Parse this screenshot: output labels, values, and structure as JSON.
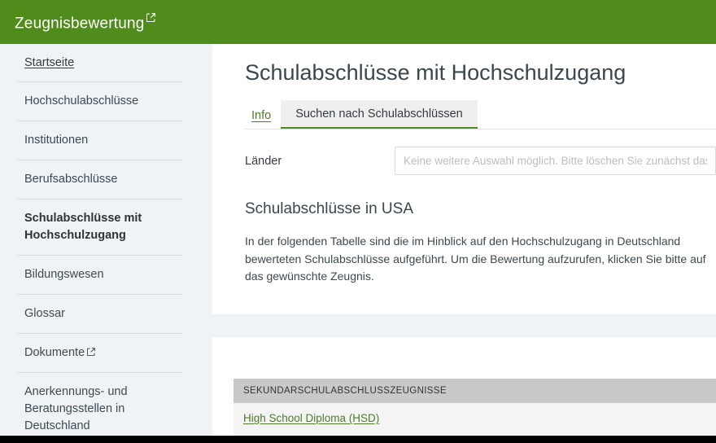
{
  "header": {
    "title": "Zeugnisbewertung",
    "external_icon": "external-link-icon",
    "bg_color": "#4f8c1b"
  },
  "sidebar": {
    "items": [
      {
        "label": "Startseite",
        "state": "link",
        "external": false
      },
      {
        "label": "Hochschulabschlüsse",
        "state": "normal",
        "external": false
      },
      {
        "label": "Institutionen",
        "state": "normal",
        "external": false
      },
      {
        "label": "Berufsabschlüsse",
        "state": "normal",
        "external": false
      },
      {
        "label": "Schulabschlüsse mit Hochschulzugang",
        "state": "active",
        "external": false
      },
      {
        "label": "Bildungswesen",
        "state": "normal",
        "external": false
      },
      {
        "label": "Glossar",
        "state": "normal",
        "external": false
      },
      {
        "label": "Dokumente",
        "state": "normal",
        "external": true
      },
      {
        "label": "Anerkennungs- und Beratungsstellen in Deutschland",
        "state": "normal",
        "external": false
      }
    ]
  },
  "main": {
    "page_title": "Schulabschlüsse mit Hochschulzugang",
    "tabs": [
      {
        "label": "Info",
        "active": false
      },
      {
        "label": "Suchen nach Schulabschlüssen",
        "active": true
      }
    ],
    "form": {
      "laender_label": "Länder",
      "laender_value": "",
      "laender_placeholder": "Keine weitere Auswahl möglich. Bitte löschen Sie zunächst das ausg"
    },
    "section": {
      "heading": "Schulabschlüsse in USA",
      "paragraph": "In der folgenden Tabelle sind die im Hinblick auf den Hochschulzugang in Deutschland bewerteten Schulabschlüsse aufgeführt. Um die Bewertung aufzurufen, klicken Sie bitte auf das gewünschte Zeugnis."
    },
    "table": {
      "header": "SEKUNDARSCHULABSCHLUSSZEUGNISSE",
      "rows": [
        {
          "label": "High School Diploma (HSD)"
        }
      ]
    }
  },
  "colors": {
    "brand_green": "#4f8c1b",
    "link_green": "#4d7c2a",
    "sidebar_bg": "#eff3f6",
    "table_header_bg": "#c9c9c9",
    "table_row_bg": "#f4f4f4"
  }
}
